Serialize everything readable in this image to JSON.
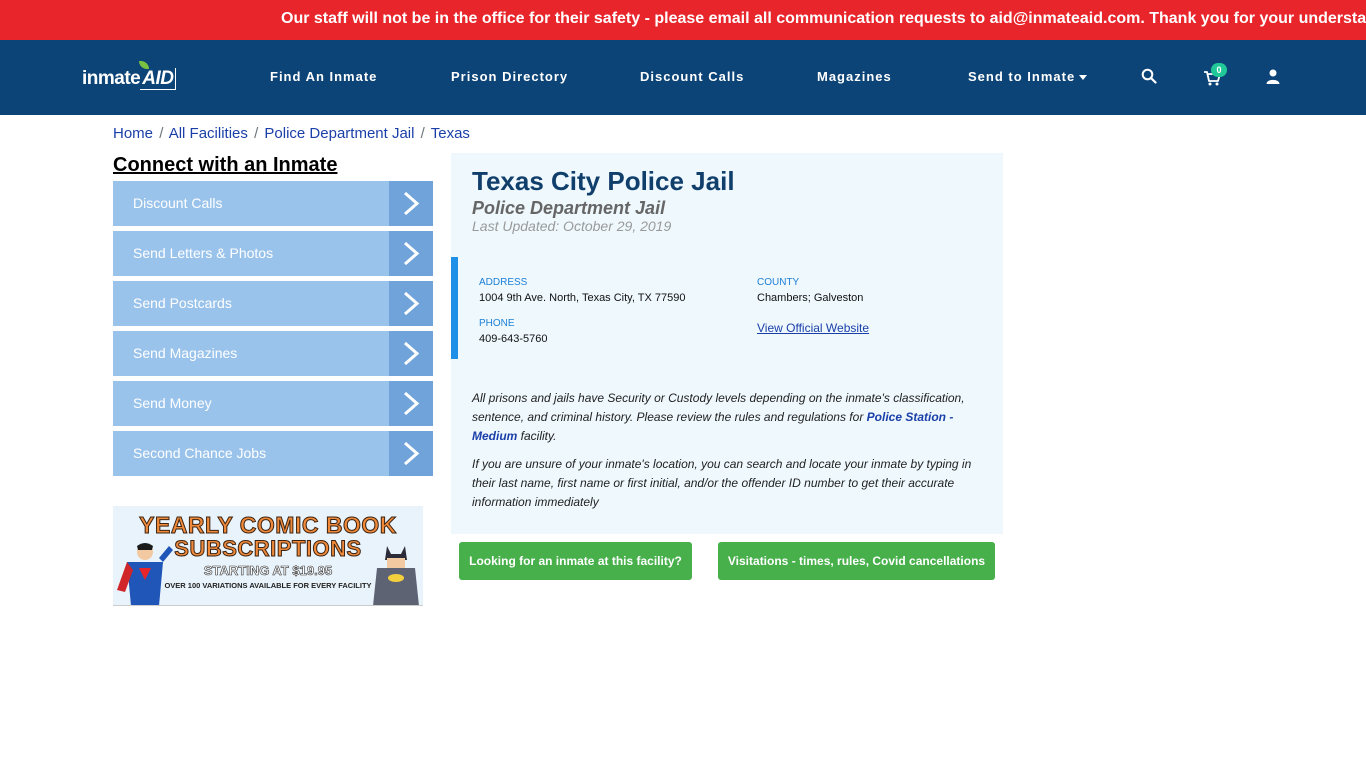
{
  "alert": {
    "text": "Our staff will not be in the office for their safety - please email all communication requests to aid@inmateaid.com. Thank you for your understanding."
  },
  "nav": {
    "logo_main": "inmate",
    "logo_accent": "AID",
    "links": [
      {
        "label": "Find An Inmate"
      },
      {
        "label": "Prison Directory"
      },
      {
        "label": "Discount Calls"
      },
      {
        "label": "Magazines"
      },
      {
        "label": "Send to Inmate"
      }
    ],
    "cart_count": "0"
  },
  "breadcrumb": [
    "Home",
    "All Facilities",
    "Police Department Jail",
    "Texas"
  ],
  "sidebar": {
    "title": "Connect with an Inmate",
    "items": [
      {
        "label": "Discount Calls"
      },
      {
        "label": "Send Letters & Photos"
      },
      {
        "label": "Send Postcards"
      },
      {
        "label": "Send Magazines"
      },
      {
        "label": "Send Money"
      },
      {
        "label": "Second Chance Jobs"
      }
    ],
    "ad": {
      "line1": "YEARLY COMIC BOOK",
      "line2": "SUBSCRIPTIONS",
      "line3": "STARTING AT $19.95",
      "line4": "OVER 100 VARIATIONS AVAILABLE FOR EVERY FACILITY"
    }
  },
  "facility": {
    "name": "Texas City Police Jail",
    "type": "Police Department Jail",
    "updated": "Last Updated: October 29, 2019",
    "address_label": "ADDRESS",
    "address": "1004 9th Ave. North, Texas City, TX 77590",
    "county_label": "COUNTY",
    "county": "Chambers; Galveston",
    "phone_label": "PHONE",
    "phone": "409-643-5760",
    "website_link": "View Official Website",
    "para1_before": "All prisons and jails have Security or Custody levels depending on the inmate's classification, sentence, and criminal history. Please review the rules and regulations for ",
    "para1_link": "Police Station - Medium",
    "para1_after": " facility.",
    "para2": "If you are unsure of your inmate's location, you can search and locate your inmate by typing in their last name, first name or first initial, and/or the offender ID number to get their accurate information immediately"
  },
  "buttons": {
    "find_inmate": "Looking for an inmate at this facility?",
    "visitations": "Visitations - times, rules, Covid cancellations"
  },
  "colors": {
    "alert": "#e8252a",
    "nav": "#0d4477",
    "sidebar_button": "#9ac3eb",
    "sidebar_arrow": "#6fa3d9",
    "card": "#eef8fd",
    "accent_bar": "#1e90e8",
    "green": "#47b04b"
  }
}
